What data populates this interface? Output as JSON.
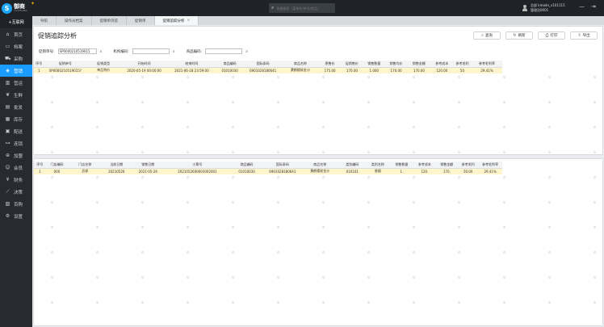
{
  "app": {
    "logo_text": "御商",
    "logo_sub": "YUSHANG",
    "search_placeholder": "快捷搜索（菜单名/单号/商品）",
    "user_line1": "总部  kmadn_v101115",
    "user_line2": "管理员0001"
  },
  "sidebar": {
    "header": "+互联网",
    "items": [
      {
        "label": "首页",
        "icon": "home-icon",
        "glyph": "⌂"
      },
      {
        "label": "档案",
        "icon": "archive-icon",
        "glyph": "▭"
      },
      {
        "label": "采购",
        "icon": "cart-icon",
        "glyph": "⛟"
      },
      {
        "label": "营销",
        "icon": "marketing-icon",
        "glyph": "◈",
        "active": true
      },
      {
        "label": "营运",
        "icon": "operations-icon",
        "glyph": "▥"
      },
      {
        "label": "生鲜",
        "icon": "fresh-icon",
        "glyph": "❦"
      },
      {
        "label": "批发",
        "icon": "wholesale-icon",
        "glyph": "▤"
      },
      {
        "label": "库存",
        "icon": "inventory-icon",
        "glyph": "▦"
      },
      {
        "label": "配送",
        "icon": "delivery-icon",
        "glyph": "▣"
      },
      {
        "label": "连锁",
        "icon": "chain-icon",
        "glyph": "⊶"
      },
      {
        "label": "加盟",
        "icon": "franchise-icon",
        "glyph": "⊕"
      },
      {
        "label": "会员",
        "icon": "member-icon",
        "glyph": "☺"
      },
      {
        "label": "财务",
        "icon": "finance-icon",
        "glyph": "¥"
      },
      {
        "label": "决策",
        "icon": "decision-icon",
        "glyph": "⟋"
      },
      {
        "label": "百购",
        "icon": "shop-icon",
        "glyph": "▧"
      },
      {
        "label": "设置",
        "icon": "settings-icon",
        "glyph": "⚙"
      }
    ]
  },
  "tabs": [
    {
      "label": "导航"
    },
    {
      "label": "操作员档案"
    },
    {
      "label": "促销单浏览"
    },
    {
      "label": "促销单"
    },
    {
      "label": "促销追踪分析",
      "active": true,
      "close": "×"
    }
  ],
  "page": {
    "title": "促销追踪分析",
    "actions": [
      {
        "label": "查询",
        "icon": "search-icon",
        "glyph": "⌕"
      },
      {
        "label": "刷新",
        "icon": "refresh-icon",
        "glyph": "↻"
      },
      {
        "label": "打印",
        "icon": "print-icon",
        "glyph": "⎙"
      },
      {
        "label": "导出",
        "icon": "export-icon",
        "glyph": "⇪"
      }
    ],
    "filters": {
      "promo_no_label": "促销单号:",
      "promo_no_value": "SP0000210519015",
      "org_label": "机构编码:",
      "org_value": "",
      "item_label": "商品编码:",
      "item_value": ""
    }
  },
  "top_table": {
    "columns": [
      "序号",
      "促销单号",
      "促销类型",
      "开始时间",
      "结束时间",
      "商品编码",
      "国际条码",
      "商品名称",
      "原售价",
      "促销售价",
      "销售数量",
      "销售均价",
      "销售金额",
      "参考成本",
      "参考毛利",
      "参考毛利率"
    ],
    "rows": [
      [
        "1",
        "SP0000210519015?",
        "单品特价",
        "2020-05-19 00:00:00",
        "2021-06-18 23:59:00",
        "01010030",
        "6901028180641",
        "黄鹤楼软金沙",
        "175.00",
        "170.00",
        "1.000",
        "170.00",
        "170.00",
        "120.00",
        "50",
        "29.41%"
      ]
    ]
  },
  "bottom_table": {
    "columns": [
      "序号",
      "门店编码",
      "门店名称",
      "当前日期",
      "销售日期",
      "小票号",
      "商品编码",
      "国际条码",
      "商品名称",
      "类别编码",
      "类别名称",
      "销售数量",
      "参考成本",
      "销售金额",
      "参考毛利",
      "参考毛利率"
    ],
    "rows": [
      [
        "1",
        "000",
        "总部",
        "20210526",
        "2021-05-26",
        "2021052600003002001",
        "01010030",
        "6901028180641",
        "黄鹤楼软金沙",
        "010101",
        "香烟",
        "1.",
        "120.",
        "170.",
        "50.00",
        "29.41%"
      ]
    ]
  }
}
